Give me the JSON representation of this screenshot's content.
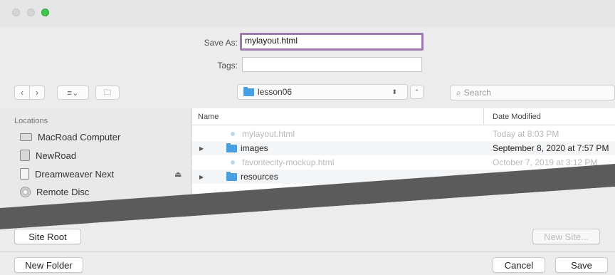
{
  "window": {
    "save_as_label": "Save As:",
    "save_as_value": "mylayout.html",
    "tags_label": "Tags:",
    "tags_value": ""
  },
  "toolbar": {
    "back_icon": "chevron-left-icon",
    "forward_icon": "chevron-right-icon",
    "view_icon": "list-view-icon",
    "new_folder_icon": "folder-icon",
    "location": "lesson06",
    "search_placeholder": "Search"
  },
  "sidebar": {
    "heading": "Locations",
    "items": [
      {
        "label": "MacRoad Computer",
        "icon": "laptop-icon"
      },
      {
        "label": "NewRoad",
        "icon": "disk-icon"
      },
      {
        "label": "Dreamweaver Next",
        "icon": "document-icon"
      },
      {
        "label": "Remote Disc",
        "icon": "disc-icon"
      }
    ]
  },
  "file_list": {
    "columns": [
      "Name",
      "Date Modified"
    ],
    "rows": [
      {
        "name": "mylayout.html",
        "date": "Today at 8:03 PM",
        "kind": "file",
        "dimmed": true
      },
      {
        "name": "images",
        "date": "September 8, 2020 at 7:57 PM",
        "kind": "folder",
        "dimmed": false
      },
      {
        "name": "favoritecity-mockup.html",
        "date": "October 7, 2019 at 3:12 PM",
        "kind": "file",
        "dimmed": true
      },
      {
        "name": "resources",
        "date": "",
        "kind": "folder",
        "dimmed": false
      }
    ]
  },
  "buttons": {
    "site_root": "Site Root",
    "new_site": "New Site...",
    "new_folder": "New Folder",
    "cancel": "Cancel",
    "save": "Save"
  },
  "colors": {
    "focus_ring": "#9d7bb0",
    "folder": "#4a9fe0",
    "band": "#5b5b5b"
  }
}
